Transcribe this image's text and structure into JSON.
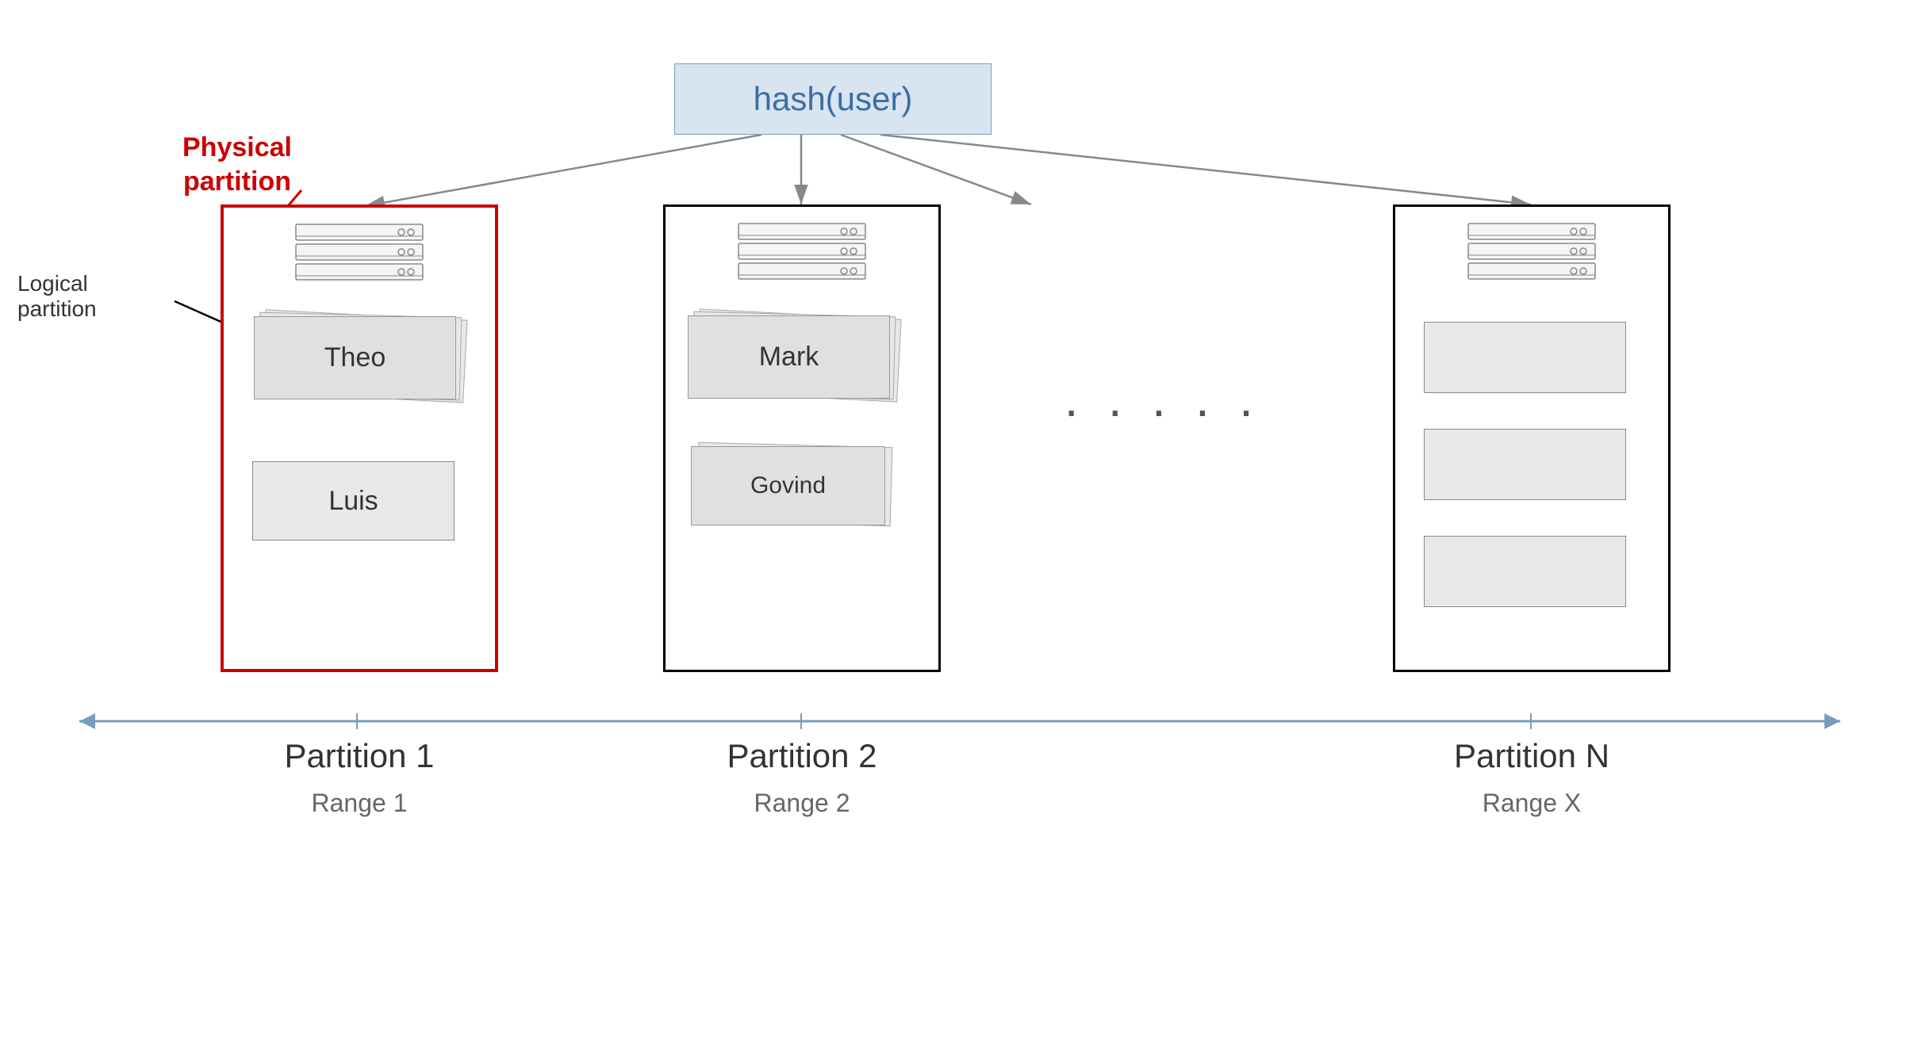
{
  "diagram": {
    "title": "hash(user)",
    "physical_partition_label": "Physical\npartition",
    "logical_partition_label": "Logical\npartition",
    "dots": "· · · · ·",
    "partitions": [
      {
        "id": "partition1",
        "label": "Partition 1",
        "range_label": "Range 1",
        "border_color": "red",
        "records": [
          "Theo",
          "Luis"
        ],
        "has_stack": true
      },
      {
        "id": "partition2",
        "label": "Partition 2",
        "range_label": "Range 2",
        "border_color": "black",
        "records": [
          "Mark",
          "Govind"
        ],
        "has_stack": true
      },
      {
        "id": "partitionN",
        "label": "Partition N",
        "range_label": "Range X",
        "border_color": "black",
        "records": [
          "",
          "",
          ""
        ],
        "has_stack": false
      }
    ]
  }
}
